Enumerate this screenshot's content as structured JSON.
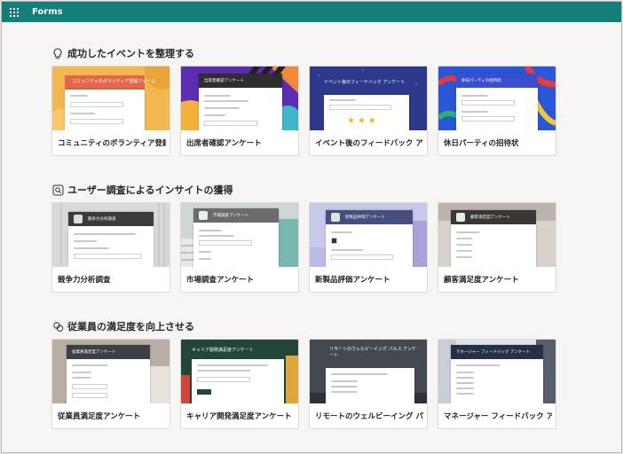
{
  "app": {
    "title": "Forms",
    "menu_icon": "waffle-icon",
    "accent": "#137f7a"
  },
  "sections": [
    {
      "title": "成功したイベントを整理する",
      "icon": "lightbulb-icon",
      "cards": [
        {
          "label": "コミュニティのボランティア登録…",
          "thumb_title": "コミュニティのボランティア登録フォーム"
        },
        {
          "label": "出席者確認アンケート",
          "thumb_title": "出席者確認アンケート"
        },
        {
          "label": "イベント後のフィードバック アン…",
          "thumb_title": "イベント後のフィードバック アンケート"
        },
        {
          "label": "休日パーティの招待状",
          "thumb_title": "休日パーティの招待状"
        }
      ]
    },
    {
      "title": "ユーザー調査によるインサイトの獲得",
      "icon": "search-icon",
      "cards": [
        {
          "label": "競争力分析調査",
          "thumb_title": "競争力分析調査"
        },
        {
          "label": "市場調査アンケート",
          "thumb_title": "市場調査アンケート"
        },
        {
          "label": "新製品評価アンケート",
          "thumb_title": "新製品評価アンケート"
        },
        {
          "label": "顧客満足度アンケート",
          "thumb_title": "顧客満足度アンケート"
        }
      ]
    },
    {
      "title": "従業員の満足度を向上させる",
      "icon": "people-icon",
      "cards": [
        {
          "label": "従業員満足度アンケート",
          "thumb_title": "従業員満足度アンケート"
        },
        {
          "label": "キャリア開発満足度アンケート",
          "thumb_title": "キャリア開発満足度アンケート"
        },
        {
          "label": "リモートのウェルビーイング パ…",
          "thumb_title": "リモートのウェルビーイング パルス アンケート"
        },
        {
          "label": "マネージャー フィードバック アン…",
          "thumb_title": "マネージャー フィードバック アンケート"
        }
      ]
    }
  ]
}
